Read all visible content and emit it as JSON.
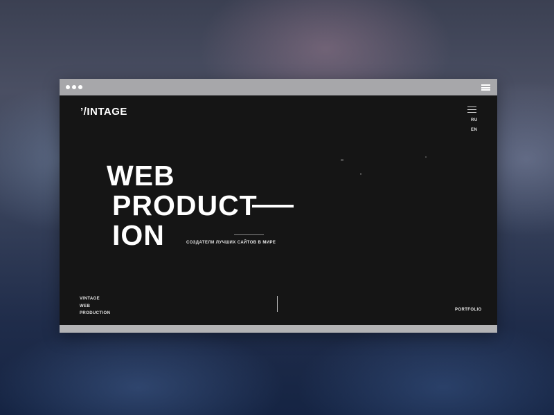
{
  "window": {
    "dots_icon": "window-dots-icon",
    "menu_icon": "hamburger-menu-icon"
  },
  "site": {
    "logo": "’/INTAGE",
    "menu_icon": "hamburger-menu-icon",
    "languages": [
      "RU",
      "EN"
    ],
    "hero": {
      "line1": "WEB",
      "line2": "PRODUCT",
      "line3": "ION"
    },
    "tagline": "СОЗДАТЕЛИ ЛУЧШИХ САЙТОВ В МИРЕ",
    "footer": {
      "brand_lines": [
        "VINTAGE",
        "WEB",
        "PRODUCTION"
      ],
      "portfolio_link": "PORTFOLIO"
    }
  },
  "colors": {
    "site_background": "#151515",
    "text": "#ffffff",
    "browser_chrome": "#a7a7aa"
  }
}
